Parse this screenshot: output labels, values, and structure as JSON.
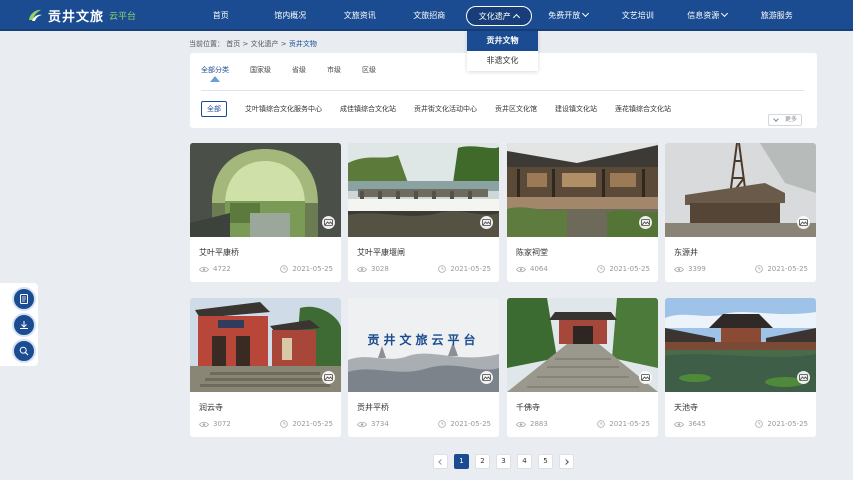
{
  "header": {
    "logo_title": "贡井文旅",
    "logo_sub": "云平台",
    "nav": [
      {
        "label": "首页",
        "has_caret": false,
        "active": false
      },
      {
        "label": "馆内概况",
        "has_caret": false,
        "active": false
      },
      {
        "label": "文旅资讯",
        "has_caret": false,
        "active": false
      },
      {
        "label": "文旅招商",
        "has_caret": false,
        "active": false
      },
      {
        "label": "文化遗产",
        "has_caret": true,
        "active": true
      },
      {
        "label": "免费开放",
        "has_caret": true,
        "active": false
      },
      {
        "label": "文艺培训",
        "has_caret": false,
        "active": false
      },
      {
        "label": "信息资源",
        "has_caret": true,
        "active": false
      },
      {
        "label": "旅游服务",
        "has_caret": false,
        "active": false
      }
    ]
  },
  "dropdown": {
    "items": [
      "贡井文物",
      "非遗文化"
    ],
    "selected": "贡井文物"
  },
  "breadcrumb": {
    "prefix": "当前位置：",
    "items": [
      "首页",
      "文化遗产",
      "贡井文物"
    ],
    "separator": " > "
  },
  "filter": {
    "levels": [
      "全部分类",
      "国家级",
      "省级",
      "市级",
      "区级"
    ],
    "active_level": "全部分类",
    "venues": [
      "全部",
      "艾叶镇综合文化服务中心",
      "成佳镇综合文化站",
      "贡井街文化活动中心",
      "贡井区文化馆",
      "建设镇文化站",
      "莲花镇综合文化站"
    ],
    "active_venue": "全部",
    "more_label": "更多"
  },
  "cards": [
    {
      "title": "艾叶平康桥",
      "views": "4722",
      "date": "2021-05-25",
      "scene": "bridge"
    },
    {
      "title": "艾叶平康堰闸",
      "views": "3028",
      "date": "2021-05-25",
      "scene": "weir"
    },
    {
      "title": "陈家祠堂",
      "views": "4064",
      "date": "2021-05-25",
      "scene": "hall"
    },
    {
      "title": "东源井",
      "views": "3399",
      "date": "2021-05-25",
      "scene": "derrick"
    },
    {
      "title": "润云寺",
      "views": "3072",
      "date": "2021-05-25",
      "scene": "temple"
    },
    {
      "title": "贡井平桥",
      "views": "3734",
      "date": "2021-05-25",
      "scene": "placeholder",
      "overlay": "贡井文旅云平台"
    },
    {
      "title": "千佛寺",
      "views": "2883",
      "date": "2021-05-25",
      "scene": "stairs"
    },
    {
      "title": "天池寺",
      "views": "3645",
      "date": "2021-05-25",
      "scene": "pond"
    }
  ],
  "pagination": {
    "pages": [
      "1",
      "2",
      "3",
      "4",
      "5"
    ],
    "current": "1"
  },
  "side_tools": [
    "document-icon",
    "download-icon",
    "search-icon"
  ],
  "colors": {
    "brand": "#1b4c92",
    "accent_green": "#8fd16a",
    "background": "#e9ecf1"
  }
}
